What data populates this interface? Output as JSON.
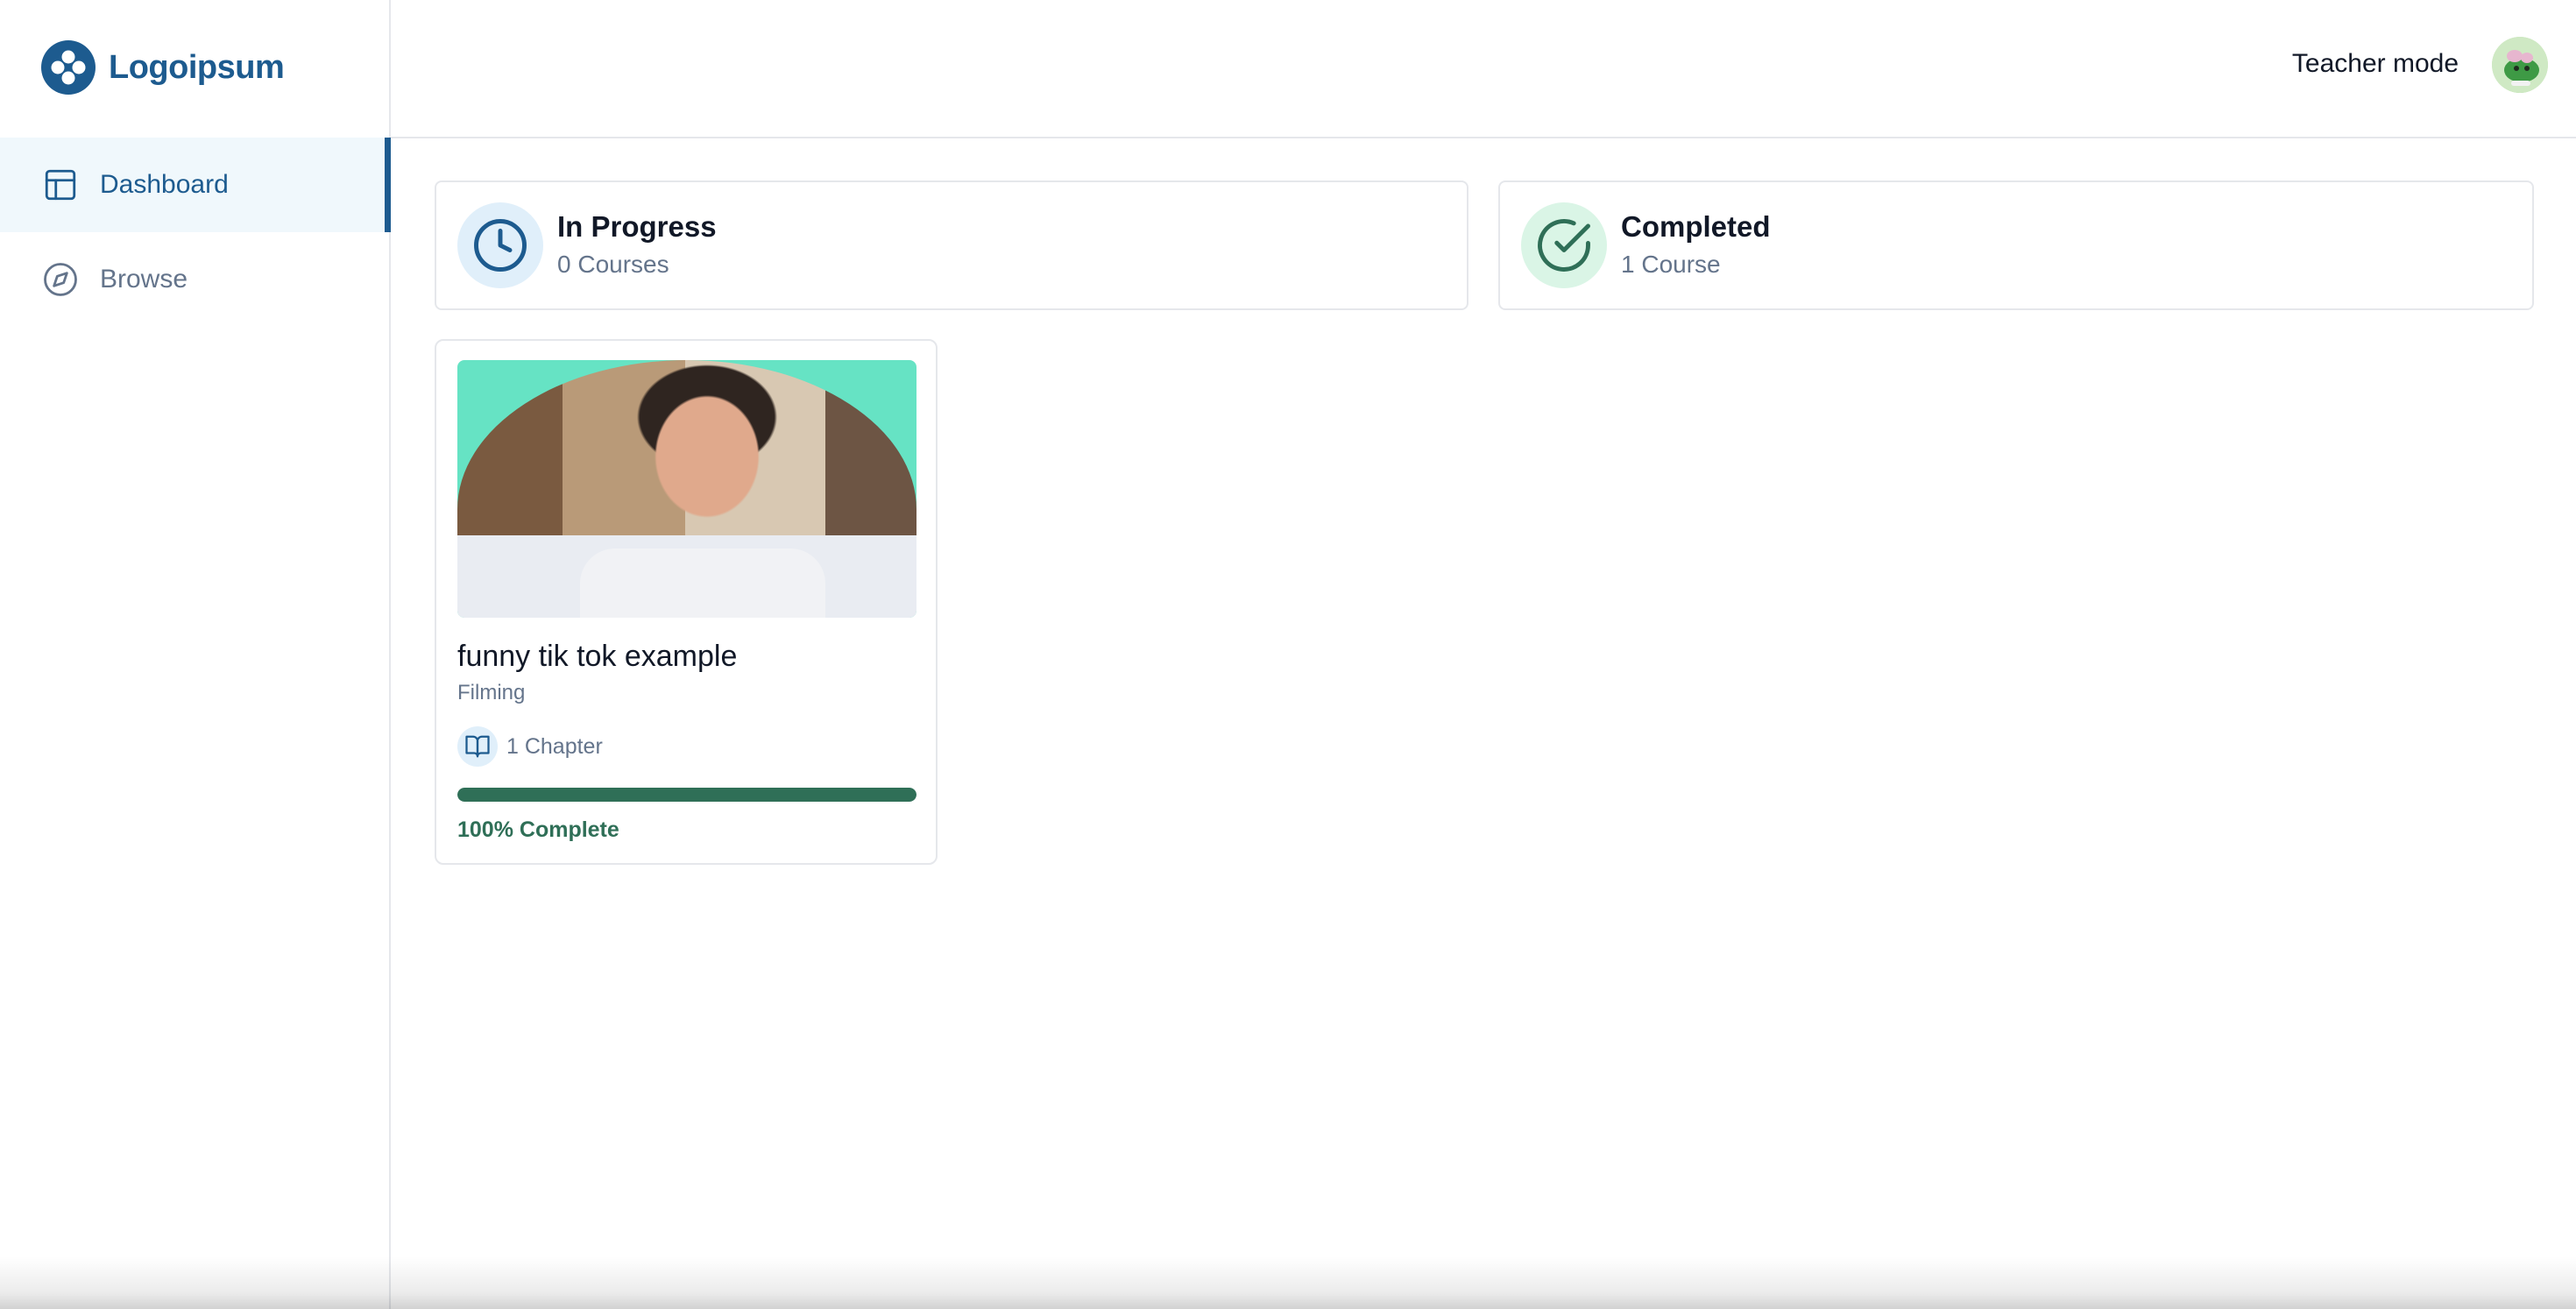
{
  "brand": {
    "name": "Logoipsum",
    "color": "#1d5b8f",
    "icon": "logo-mark-icon"
  },
  "sidebar": {
    "items": [
      {
        "label": "Dashboard",
        "icon": "layout-icon",
        "active": true
      },
      {
        "label": "Browse",
        "icon": "compass-icon",
        "active": false
      }
    ]
  },
  "header": {
    "teacher_mode_label": "Teacher mode",
    "avatar_icon": "user-avatar"
  },
  "stats": {
    "in_progress": {
      "title": "In Progress",
      "count_text": "0 Courses",
      "icon": "clock-icon",
      "color": "#1d5b8f"
    },
    "completed": {
      "title": "Completed",
      "count_text": "1 Course",
      "icon": "check-circle-icon",
      "color": "#2f6f57"
    }
  },
  "courses": [
    {
      "title": "funny tik tok example",
      "category": "Filming",
      "chapters_text": "1 Chapter",
      "chapter_icon": "book-open-icon",
      "progress": 100,
      "progress_text": "100% Complete",
      "progress_color": "#2f6f57"
    }
  ]
}
